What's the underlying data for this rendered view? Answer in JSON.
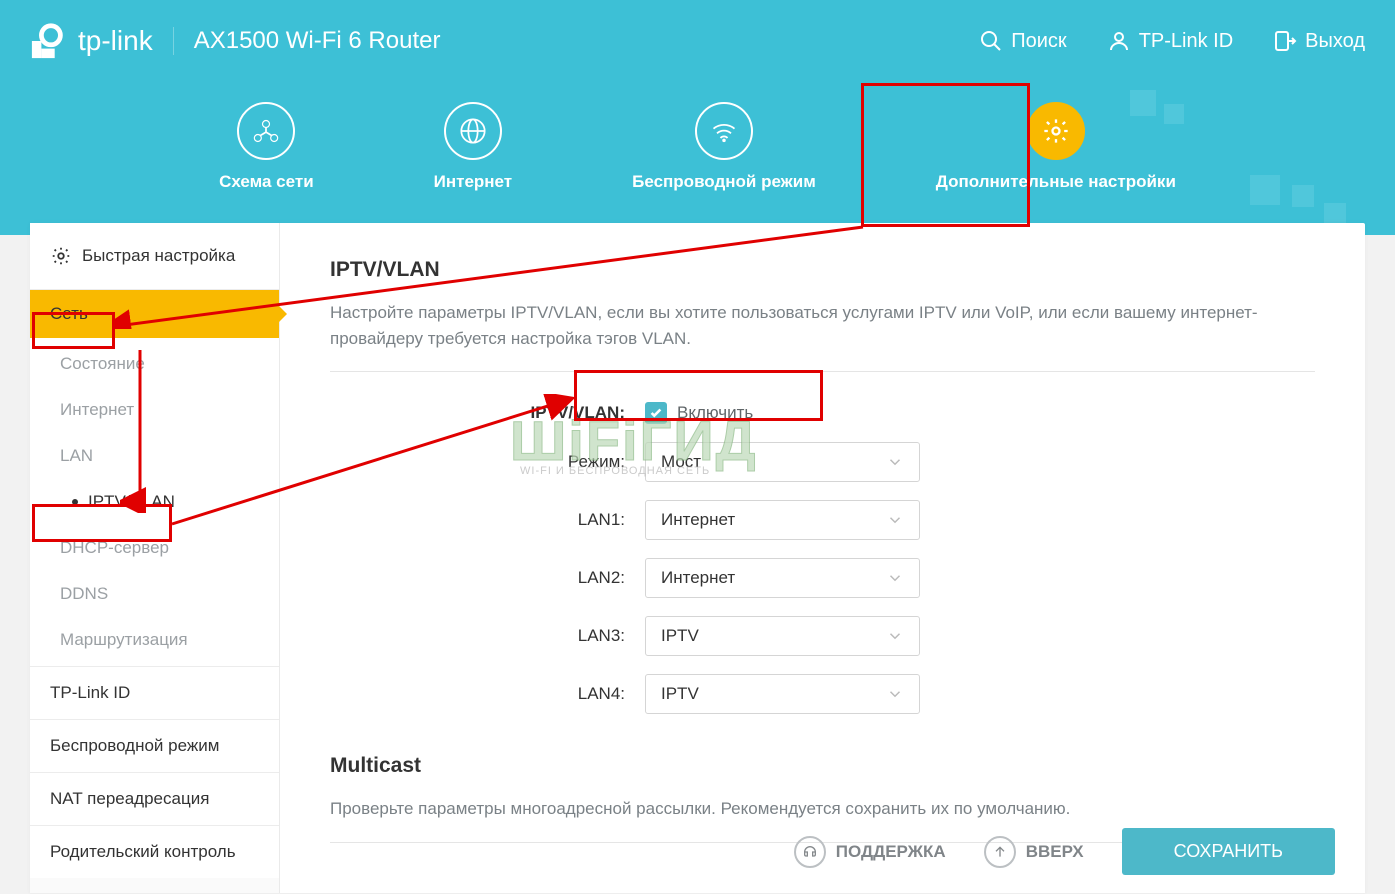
{
  "header": {
    "brand": "tp-link",
    "model": "AX1500 Wi-Fi 6 Router",
    "links": {
      "search": "Поиск",
      "id": "TP-Link ID",
      "logout": "Выход"
    }
  },
  "tabs": [
    {
      "label": "Схема сети"
    },
    {
      "label": "Интернет"
    },
    {
      "label": "Беспроводной режим"
    },
    {
      "label": "Дополнительные настройки"
    }
  ],
  "sidebar": {
    "quick": "Быстрая настройка",
    "active": "Сеть",
    "sub": [
      {
        "label": "Состояние"
      },
      {
        "label": "Интернет"
      },
      {
        "label": "LAN"
      },
      {
        "label": "IPTV/VLAN"
      },
      {
        "label": "DHCP-сервер"
      },
      {
        "label": "DDNS"
      },
      {
        "label": "Маршрутизация"
      }
    ],
    "rest": [
      {
        "label": "TP-Link ID"
      },
      {
        "label": "Беспроводной режим"
      },
      {
        "label": "NAT переадресация"
      },
      {
        "label": "Родительский контроль"
      }
    ]
  },
  "main": {
    "title": "IPTV/VLAN",
    "desc": "Настройте параметры IPTV/VLAN, если вы хотите пользоваться услугами IPTV или VoIP, или если вашему интернет-провайдеру требуется настройка тэгов VLAN.",
    "enable_label": "IPTV/VLAN:",
    "enable_text": "Включить",
    "fields": [
      {
        "label": "Режим:",
        "value": "Мост"
      },
      {
        "label": "LAN1:",
        "value": "Интернет"
      },
      {
        "label": "LAN2:",
        "value": "Интернет"
      },
      {
        "label": "LAN3:",
        "value": "IPTV"
      },
      {
        "label": "LAN4:",
        "value": "IPTV"
      }
    ],
    "multicast_title": "Multicast",
    "multicast_desc": "Проверьте параметры многоадресной рассылки. Рекомендуется сохранить их по умолчанию."
  },
  "footer": {
    "support": "ПОДДЕРЖКА",
    "up": "ВВЕРХ",
    "save": "СОХРАНИТЬ"
  },
  "watermark": {
    "main": "ШіFіГИД",
    "sub": "WI-FI И БЕСПРОВОДНАЯ СЕТЬ"
  }
}
